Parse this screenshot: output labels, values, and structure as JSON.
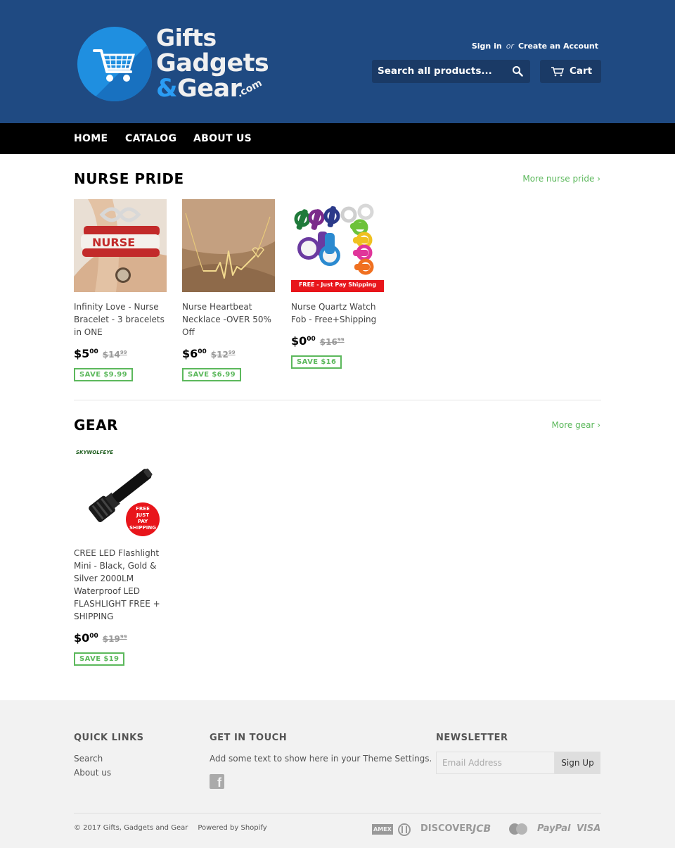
{
  "header": {
    "logo": {
      "line1": "Gifts",
      "line2": "Gadgets",
      "amp": "&",
      "line3": "Gear",
      "com": ".com"
    },
    "sign_in": "Sign in",
    "or": "or",
    "create_account": "Create an Account",
    "search_placeholder": "Search all products...",
    "cart_label": "Cart"
  },
  "nav": {
    "items": [
      "HOME",
      "CATALOG",
      "ABOUT US"
    ]
  },
  "collections": [
    {
      "title": "NURSE PRIDE",
      "more": "More nurse pride ›",
      "products": [
        {
          "name": "Infinity Love - Nurse Bracelet - 3 bracelets in ONE",
          "price_main": "$5",
          "price_cents": "00",
          "compare_main": "$14",
          "compare_cents": "99",
          "save": "SAVE $9.99"
        },
        {
          "name": "Nurse Heartbeat Necklace -OVER 50% Off",
          "price_main": "$6",
          "price_cents": "00",
          "compare_main": "$12",
          "compare_cents": "99",
          "save": "SAVE $6.99"
        },
        {
          "name": "Nurse Quartz Watch Fob - Free+Shipping",
          "price_main": "$0",
          "price_cents": "00",
          "compare_main": "$16",
          "compare_cents": "99",
          "save": "SAVE $16",
          "banner": "FREE - Just Pay Shipping"
        }
      ]
    },
    {
      "title": "GEAR",
      "more": "More gear ›",
      "products": [
        {
          "name": "CREE LED Flashlight Mini - Black, Gold & Silver 2000LM Waterproof LED FLASHLIGHT FREE + SHIPPING",
          "price_main": "$0",
          "price_cents": "00",
          "compare_main": "$19",
          "compare_cents": "99",
          "save": "SAVE $19",
          "brand": "SKYWOLFEYE",
          "badge": [
            "FREE",
            "JUST",
            "PAY",
            "SHIPPING"
          ]
        }
      ]
    }
  ],
  "footer": {
    "quick_links_title": "QUICK LINKS",
    "quick_links": [
      "Search",
      "About us"
    ],
    "touch_title": "GET IN TOUCH",
    "touch_text": "Add some text to show here in your Theme Settings.",
    "newsletter_title": "NEWSLETTER",
    "email_placeholder": "Email Address",
    "signup_label": "Sign Up",
    "copyright": "© 2017 Gifts, Gadgets and Gear",
    "powered": "Powered by Shopify",
    "payments": [
      "AMEX",
      "Diners",
      "DISCOVER",
      "JCB",
      "Master",
      "PayPal",
      "VISA"
    ]
  },
  "colors": {
    "header_bg": "#1f4a82",
    "nav_bg": "#000000",
    "accent": "#5cb85c",
    "footer_bg": "#f2f2f2"
  }
}
